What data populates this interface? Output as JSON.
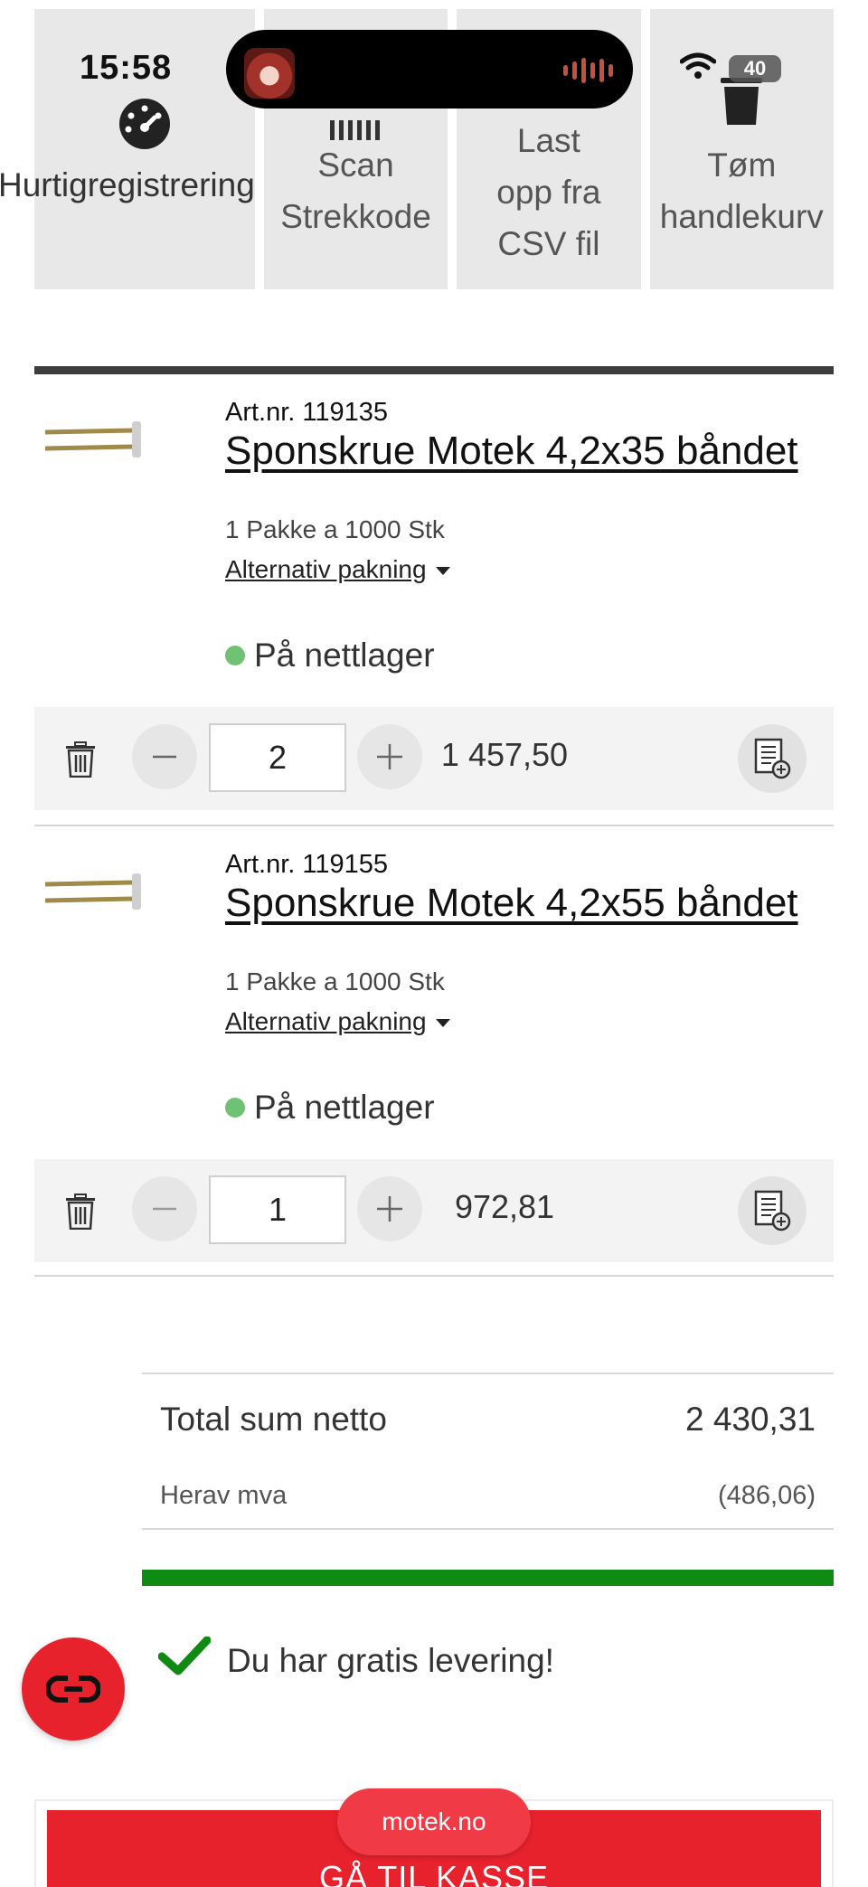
{
  "status_bar": {
    "time": "15:58",
    "battery": "40"
  },
  "tiles": [
    {
      "label": "Hurtigregistrering",
      "icon": "speedometer-icon"
    },
    {
      "label": "Scan\nStrekkode",
      "icon": "barcode-icon"
    },
    {
      "label": "Last\nopp fra\nCSV fil",
      "icon": "upload-icon"
    },
    {
      "label": "Tøm\nhandlekurv",
      "icon": "trash-icon"
    }
  ],
  "products": [
    {
      "art_nr": "Art.nr. 119135",
      "title": "Sponskrue Motek 4,2x35 båndet",
      "pack": "1 Pakke a 1000 Stk",
      "alt_pack": "Alternativ pakning",
      "stock": "På nettlager",
      "quantity": "2",
      "price": "1 457,50"
    },
    {
      "art_nr": "Art.nr. 119155",
      "title": "Sponskrue Motek 4,2x55 båndet",
      "pack": "1 Pakke a 1000 Stk",
      "alt_pack": "Alternativ pakning",
      "stock": "På nettlager",
      "quantity": "1",
      "price": "972,81"
    }
  ],
  "totals": {
    "label": "Total sum netto",
    "value": "2 430,31",
    "mva_label": "Herav mva",
    "mva_value": "(486,06)"
  },
  "free_delivery_progress": 1.0,
  "free_delivery_text": "Du har gratis levering!",
  "checkout_label": "GÅ TIL KASSE",
  "url": "motek.no",
  "colors": {
    "accent_red": "#e8222d",
    "progress_green": "#0f8a12",
    "stock_green": "#6fc274"
  }
}
